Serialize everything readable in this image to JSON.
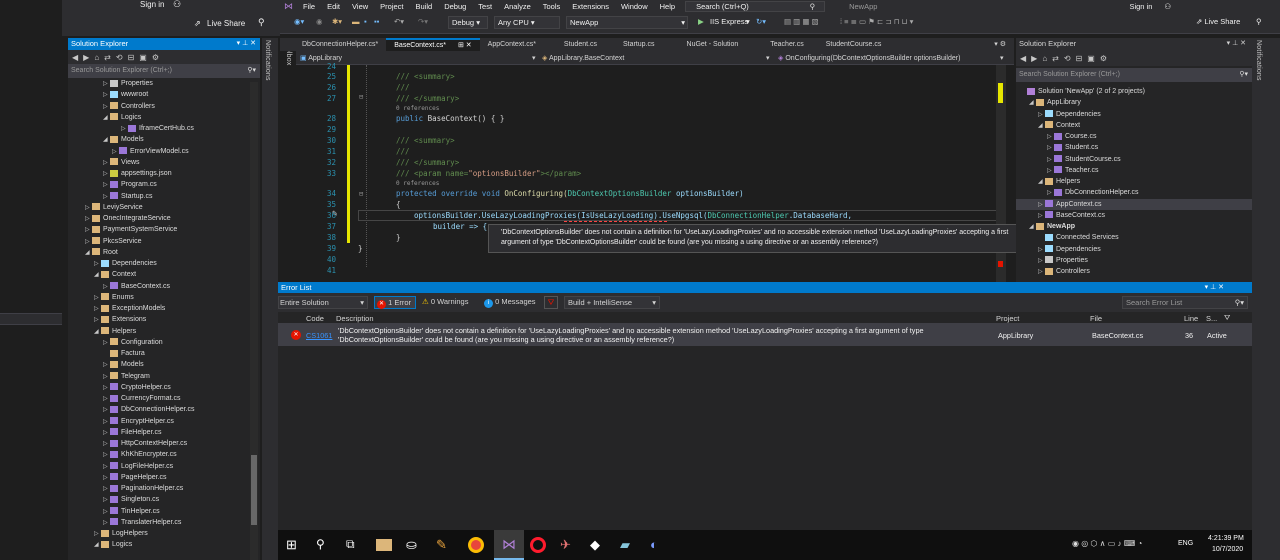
{
  "titlebar": {
    "sign_in": "Sign in",
    "live_share": "Live Share",
    "app_name": "NewApp",
    "search_placeholder": "Search (Ctrl+Q)"
  },
  "menu": [
    "File",
    "Edit",
    "View",
    "Project",
    "Build",
    "Debug",
    "Test",
    "Analyze",
    "Tools",
    "Extensions",
    "Window",
    "Help"
  ],
  "toolbar": {
    "config": "Debug",
    "platform": "Any CPU",
    "startup": "NewApp",
    "run": "IIS Express"
  },
  "left_explorer": {
    "title": "Solution Explorer",
    "search": "Search Solution Explorer (Ctrl+;)",
    "items": [
      {
        "label": "Properties",
        "indent": 3,
        "arrow": "▷"
      },
      {
        "label": "wwwroot",
        "indent": 3,
        "arrow": "▷"
      },
      {
        "label": "Controllers",
        "indent": 3,
        "arrow": "▷"
      },
      {
        "label": "Logics",
        "indent": 3,
        "arrow": "◢"
      },
      {
        "label": "IframeCertHub.cs",
        "indent": 5,
        "arrow": "▷"
      },
      {
        "label": "Models",
        "indent": 3,
        "arrow": "◢"
      },
      {
        "label": "ErrorViewModel.cs",
        "indent": 4,
        "arrow": "▷"
      },
      {
        "label": "Views",
        "indent": 3,
        "arrow": "▷"
      },
      {
        "label": "appsettings.json",
        "indent": 3,
        "arrow": "▷"
      },
      {
        "label": "Program.cs",
        "indent": 3,
        "arrow": "▷"
      },
      {
        "label": "Startup.cs",
        "indent": 3,
        "arrow": "▷"
      },
      {
        "label": "LeviyService",
        "indent": 1,
        "arrow": "▷"
      },
      {
        "label": "OnecIntegrateService",
        "indent": 1,
        "arrow": "▷"
      },
      {
        "label": "PaymentSystemService",
        "indent": 1,
        "arrow": "▷"
      },
      {
        "label": "PkcsService",
        "indent": 1,
        "arrow": "▷"
      },
      {
        "label": "Root",
        "indent": 1,
        "arrow": "◢"
      },
      {
        "label": "Dependencies",
        "indent": 2,
        "arrow": "▷"
      },
      {
        "label": "Context",
        "indent": 2,
        "arrow": "◢"
      },
      {
        "label": "BaseContext.cs",
        "indent": 3,
        "arrow": "▷"
      },
      {
        "label": "Enums",
        "indent": 2,
        "arrow": "▷"
      },
      {
        "label": "ExceptionModels",
        "indent": 2,
        "arrow": "▷"
      },
      {
        "label": "Extensions",
        "indent": 2,
        "arrow": "▷"
      },
      {
        "label": "Helpers",
        "indent": 2,
        "arrow": "◢"
      },
      {
        "label": "Configuration",
        "indent": 3,
        "arrow": "▷"
      },
      {
        "label": "Factura",
        "indent": 3,
        "arrow": ""
      },
      {
        "label": "Models",
        "indent": 3,
        "arrow": "▷"
      },
      {
        "label": "Telegram",
        "indent": 3,
        "arrow": "▷"
      },
      {
        "label": "CryptoHelper.cs",
        "indent": 3,
        "arrow": "▷"
      },
      {
        "label": "CurrencyFormat.cs",
        "indent": 3,
        "arrow": "▷"
      },
      {
        "label": "DbConnectionHelper.cs",
        "indent": 3,
        "arrow": "▷"
      },
      {
        "label": "EncryptHelper.cs",
        "indent": 3,
        "arrow": "▷"
      },
      {
        "label": "FileHelper.cs",
        "indent": 3,
        "arrow": "▷"
      },
      {
        "label": "HttpContextHelper.cs",
        "indent": 3,
        "arrow": "▷"
      },
      {
        "label": "KhKhEncrypter.cs",
        "indent": 3,
        "arrow": "▷"
      },
      {
        "label": "LogFileHelper.cs",
        "indent": 3,
        "arrow": "▷"
      },
      {
        "label": "PageHelper.cs",
        "indent": 3,
        "arrow": "▷"
      },
      {
        "label": "PaginationHelper.cs",
        "indent": 3,
        "arrow": "▷"
      },
      {
        "label": "Singleton.cs",
        "indent": 3,
        "arrow": "▷"
      },
      {
        "label": "TinHelper.cs",
        "indent": 3,
        "arrow": "▷"
      },
      {
        "label": "TranslaterHelper.cs",
        "indent": 3,
        "arrow": "▷"
      },
      {
        "label": "LogHelpers",
        "indent": 2,
        "arrow": "▷"
      },
      {
        "label": "Logics",
        "indent": 2,
        "arrow": "◢"
      }
    ]
  },
  "side_labels": {
    "notifications": "Notifications",
    "toolbox": "Toolbox"
  },
  "tabs": [
    "DbConnectionHelper.cs*",
    "BaseContext.cs*",
    "AppContext.cs*",
    "Student.cs",
    "Startup.cs",
    "NuGet - Solution",
    "Teacher.cs",
    "StudentCourse.cs"
  ],
  "navbar": {
    "project": "AppLibrary",
    "class": "AppLibrary.BaseContext",
    "member": "OnConfiguring(DbContextOptionsBuilder optionsBuilder)"
  },
  "code": {
    "l24": "24",
    "l25": "25",
    "c25": "/// <summary>",
    "l26": "26",
    "c26": "///",
    "l27": "27",
    "c27": "/// </summary>",
    "refs": "0 references",
    "l28": "28",
    "c28a": "public ",
    "c28b": "BaseContext() { }",
    "l29": "29",
    "l30": "30",
    "c30": "/// <summary>",
    "l31": "31",
    "c31": "///",
    "l32": "32",
    "c32": "/// </summary>",
    "l33": "33",
    "c33a": "/// <param name=",
    "c33b": "\"optionsBuilder\"",
    "c33c": "></param>",
    "l34": "34",
    "c34a": "protected override void ",
    "c34b": "OnConfiguring(",
    "c34c": "DbContextOptionsBuilder",
    "c34d": " optionsBuilder)",
    "l35": "35",
    "c35": "{",
    "l36": "36",
    "c36a": "optionsBuilder.UseLazyLoadingProxies(IsUseLazyLoading).UseNpgsql(",
    "c36b": "DbConnectionHelper",
    ".c36c": "",
    "c36d": ".DatabaseHard,",
    "l37": "37",
    "c37": "builder => {",
    "l38": "38",
    "c38": "}",
    "l39": "39",
    "c39": "}",
    "l40": "40",
    "l41": "41"
  },
  "tooltip": "'DbContextOptionsBuilder' does not contain a definition for 'UseLazyLoadingProxies' and no accessible extension method 'UseLazyLoadingProxies' accepting a first argument of type 'DbContextOptionsBuilder' could be found (are you missing a using directive or an assembly reference?)",
  "errorlist": {
    "title": "Error List",
    "scope": "Entire Solution",
    "errors": "1 Error",
    "warnings": "0 Warnings",
    "messages": "0 Messages",
    "build": "Build + IntelliSense",
    "search": "Search Error List",
    "headers": {
      "code": "Code",
      "description": "Description",
      "project": "Project",
      "file": "File",
      "line": "Line",
      "state": "S..."
    },
    "row": {
      "code": "CS1061",
      "description": "'DbContextOptionsBuilder' does not contain a definition for 'UseLazyLoadingProxies' and no accessible extension method 'UseLazyLoadingProxies' accepting a first argument of type 'DbContextOptionsBuilder' could be found (are you missing a using directive or an assembly reference?)",
      "project": "AppLibrary",
      "file": "BaseContext.cs",
      "line": "36",
      "state": "Active"
    }
  },
  "right_explorer": {
    "title": "Solution Explorer",
    "search": "Search Solution Explorer (Ctrl+;)",
    "items": [
      {
        "label": "Solution 'NewApp' (2 of 2 projects)",
        "indent": 0,
        "arrow": ""
      },
      {
        "label": "AppLibrary",
        "indent": 1,
        "arrow": "◢"
      },
      {
        "label": "Dependencies",
        "indent": 2,
        "arrow": "▷"
      },
      {
        "label": "Context",
        "indent": 2,
        "arrow": "◢"
      },
      {
        "label": "Course.cs",
        "indent": 3,
        "arrow": "▷"
      },
      {
        "label": "Student.cs",
        "indent": 3,
        "arrow": "▷"
      },
      {
        "label": "StudentCourse.cs",
        "indent": 3,
        "arrow": "▷"
      },
      {
        "label": "Teacher.cs",
        "indent": 3,
        "arrow": "▷"
      },
      {
        "label": "Helpers",
        "indent": 2,
        "arrow": "◢"
      },
      {
        "label": "DbConnectionHelper.cs",
        "indent": 3,
        "arrow": "▷"
      },
      {
        "label": "AppContext.cs",
        "indent": 2,
        "arrow": "▷"
      },
      {
        "label": "BaseContext.cs",
        "indent": 2,
        "arrow": "▷"
      },
      {
        "label": "NewApp",
        "indent": 1,
        "arrow": "◢"
      },
      {
        "label": "Connected Services",
        "indent": 2,
        "arrow": ""
      },
      {
        "label": "Dependencies",
        "indent": 2,
        "arrow": "▷"
      },
      {
        "label": "Properties",
        "indent": 2,
        "arrow": "▷"
      },
      {
        "label": "Controllers",
        "indent": 2,
        "arrow": "▷"
      }
    ]
  },
  "taskbar": {
    "time": "4:21:39 PM",
    "date": "10/7/2020",
    "lang": "ENG"
  },
  "colors": {
    "accent": "#007acc",
    "bg": "#1e1e1e",
    "panel": "#252526",
    "error": "#e51400"
  }
}
